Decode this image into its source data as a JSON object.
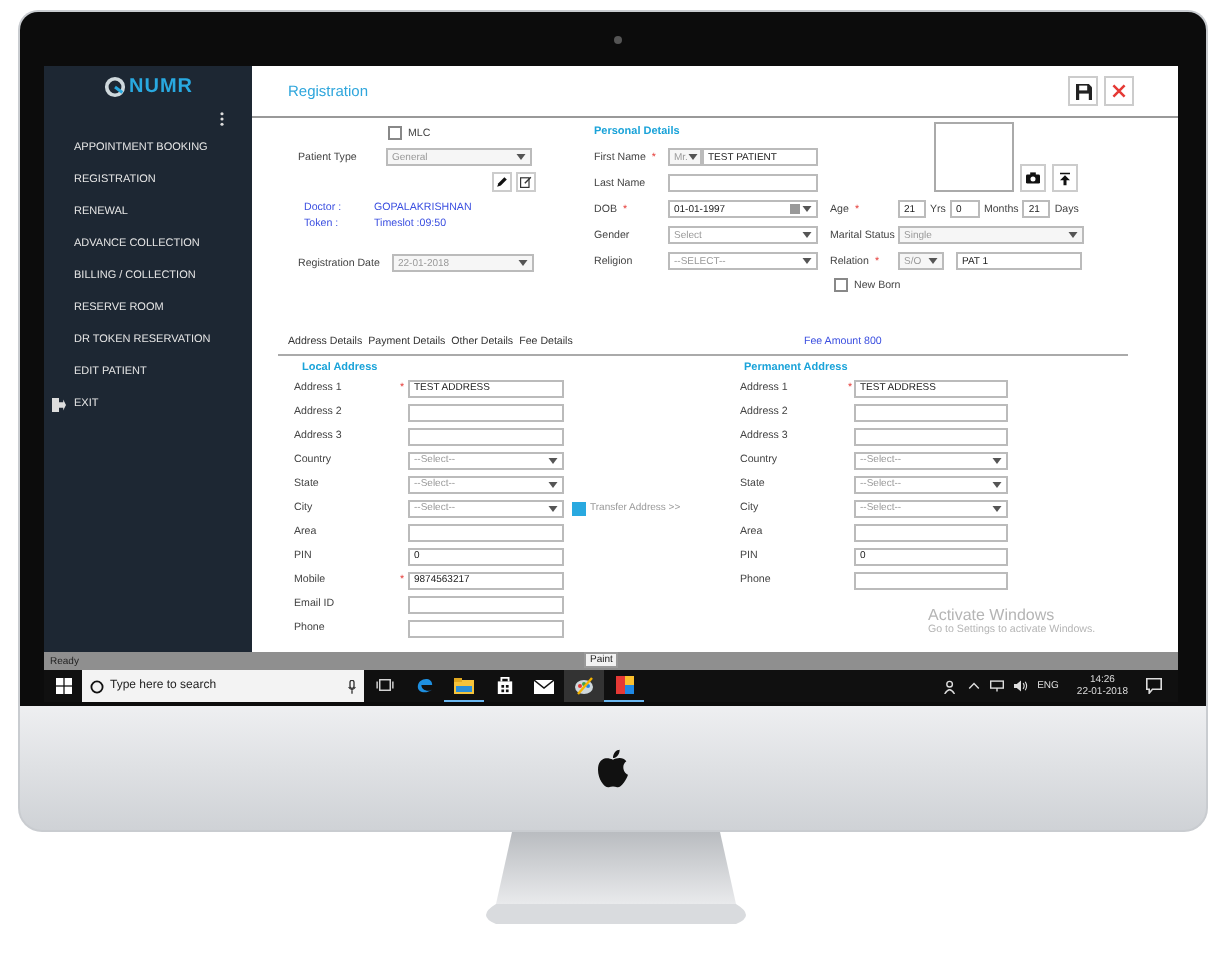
{
  "sidebar": {
    "logo": "NUMR",
    "items": [
      {
        "label": "APPOINTMENT BOOKING",
        "kind": "link"
      },
      {
        "label": "REGISTRATION",
        "kind": "link"
      },
      {
        "label": "RENEWAL",
        "kind": "link"
      },
      {
        "label": "ADVANCE COLLECTION",
        "kind": "link"
      },
      {
        "label": "BILLING / COLLECTION",
        "kind": "link"
      },
      {
        "label": "RESERVE ROOM",
        "kind": "link"
      },
      {
        "label": "DR TOKEN RESERVATION",
        "kind": "link"
      },
      {
        "label": "EDIT PATIENT",
        "kind": "link"
      },
      {
        "label": "EXIT",
        "kind": "exit"
      }
    ]
  },
  "header": {
    "title": "Registration"
  },
  "registration": {
    "mlc": {
      "label": "MLC",
      "checked": false
    },
    "patient_type": {
      "label": "Patient Type",
      "value": "General",
      "disabled": true
    },
    "doctor": {
      "label": "Doctor :",
      "value": "GOPALAKRISHNAN"
    },
    "token": {
      "label": "Token :",
      "value": "Timeslot :09:50"
    },
    "registration_date": {
      "label": "Registration Date",
      "value": "22-01-2018",
      "disabled": true
    }
  },
  "personal_details": {
    "heading": "Personal  Details",
    "first_name": {
      "label": "First Name",
      "mark": "*",
      "title": {
        "value": "Mr.",
        "disabled": true
      },
      "value": "TEST PATIENT"
    },
    "last_name": {
      "label": "Last Name"
    },
    "dob": {
      "label": "DOB",
      "mark": "*",
      "value": "01-01-1997"
    },
    "age": {
      "label": "Age",
      "mark": "*",
      "years": "21",
      "years_unit": "Yrs",
      "months": "0",
      "months_unit": "Months",
      "days": "21",
      "days_unit": "Days"
    },
    "gender": {
      "label": "Gender",
      "placeholder": "Select"
    },
    "marital_status": {
      "label": "Marital Status",
      "value": "Single",
      "disabled": true
    },
    "religion": {
      "label": "Religion",
      "placeholder": "--SELECT--"
    },
    "relation": {
      "label": "Relation",
      "mark": "*",
      "type": {
        "value": "S/O",
        "disabled": true
      },
      "value": "PAT 1"
    },
    "new_born": {
      "label": "New Born",
      "checked": false
    }
  },
  "tabs": [
    {
      "label": "Address Details"
    },
    {
      "label": "Payment Details"
    },
    {
      "label": "Other Details"
    },
    {
      "label": "Fee Details"
    }
  ],
  "fee_amount": "Fee Amount 800",
  "local_address": {
    "heading": "Local Address",
    "fields": [
      {
        "label": "Address 1",
        "mark": "*",
        "kind": "text",
        "value": "TEST ADDRESS"
      },
      {
        "label": "Address 2",
        "kind": "text"
      },
      {
        "label": "Address 3",
        "kind": "text"
      },
      {
        "label": "Country",
        "kind": "select",
        "placeholder": "--Select--"
      },
      {
        "label": "State",
        "kind": "select",
        "placeholder": "--Select--"
      },
      {
        "label": "City",
        "kind": "select",
        "placeholder": "--Select--",
        "transfer": {
          "label": "Transfer Address >>",
          "checked": true
        }
      },
      {
        "label": "Area",
        "kind": "text"
      },
      {
        "label": "PIN",
        "kind": "text",
        "value": "0"
      },
      {
        "label": "Mobile",
        "mark": "*",
        "kind": "text",
        "value": "9874563217"
      },
      {
        "label": "Email ID",
        "kind": "text"
      },
      {
        "label": "Phone",
        "kind": "text"
      }
    ]
  },
  "permanent_address": {
    "heading": "Permanent Address",
    "fields": [
      {
        "label": "Address 1",
        "mark": "*",
        "kind": "text",
        "value": "TEST ADDRESS"
      },
      {
        "label": "Address 2",
        "kind": "text"
      },
      {
        "label": "Address 3",
        "kind": "text"
      },
      {
        "label": "Country",
        "kind": "select",
        "placeholder": "--Select--"
      },
      {
        "label": "State",
        "kind": "select",
        "placeholder": "--Select--"
      },
      {
        "label": "City",
        "kind": "select",
        "placeholder": "--Select--"
      },
      {
        "label": "Area",
        "kind": "text"
      },
      {
        "label": "PIN",
        "kind": "text",
        "value": "0"
      },
      {
        "label": "Phone",
        "kind": "text"
      }
    ]
  },
  "activation_notice": {
    "title": "Activate Windows",
    "subtitle": "Go to Settings to activate Windows."
  },
  "status_bar": "Ready",
  "taskbar": {
    "search_placeholder": "Type here to search",
    "apps": [
      {
        "kind": "task-view",
        "running": false
      },
      {
        "kind": "edge",
        "running": false
      },
      {
        "kind": "folder",
        "running": true
      },
      {
        "kind": "store",
        "running": false
      },
      {
        "kind": "mail",
        "running": false
      },
      {
        "kind": "paint",
        "running": false,
        "tooltip": "Paint"
      },
      {
        "kind": "app",
        "running": true
      }
    ],
    "language": "ENG",
    "time": "14:26",
    "date": "22-01-2018"
  }
}
